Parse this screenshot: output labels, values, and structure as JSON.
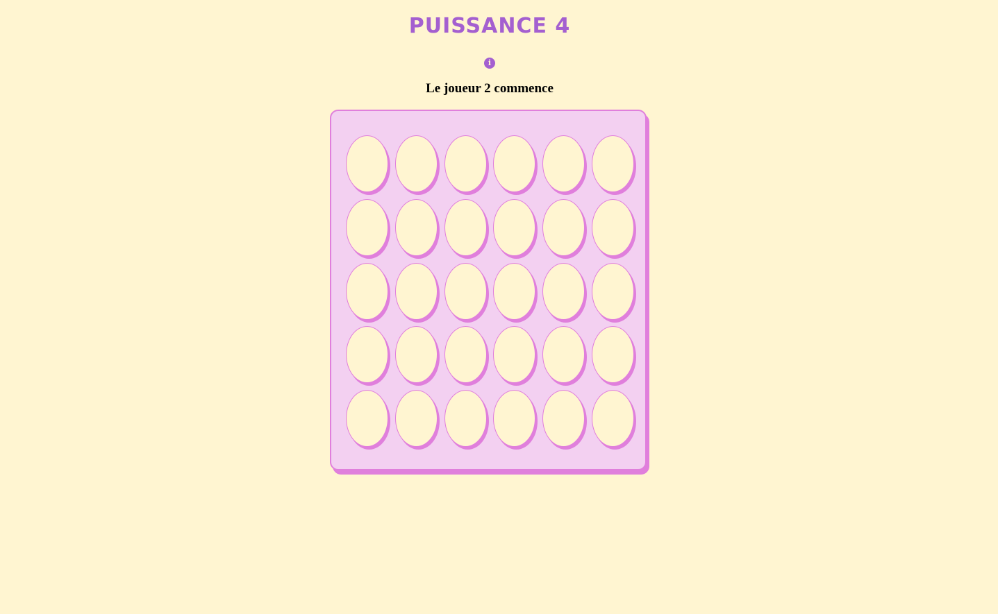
{
  "title": "PUISSANCE 4",
  "info_icon": "info-icon",
  "status": "Le joueur 2 commence",
  "board": {
    "rows": 5,
    "columns": 6,
    "cells": [
      [
        "empty",
        "empty",
        "empty",
        "empty",
        "empty",
        "empty"
      ],
      [
        "empty",
        "empty",
        "empty",
        "empty",
        "empty",
        "empty"
      ],
      [
        "empty",
        "empty",
        "empty",
        "empty",
        "empty",
        "empty"
      ],
      [
        "empty",
        "empty",
        "empty",
        "empty",
        "empty",
        "empty"
      ],
      [
        "empty",
        "empty",
        "empty",
        "empty",
        "empty",
        "empty"
      ]
    ]
  },
  "colors": {
    "background": "#fff5d1",
    "accent": "#a45fd0",
    "board": "#f3d0f1",
    "board_border": "#e07fdc"
  }
}
